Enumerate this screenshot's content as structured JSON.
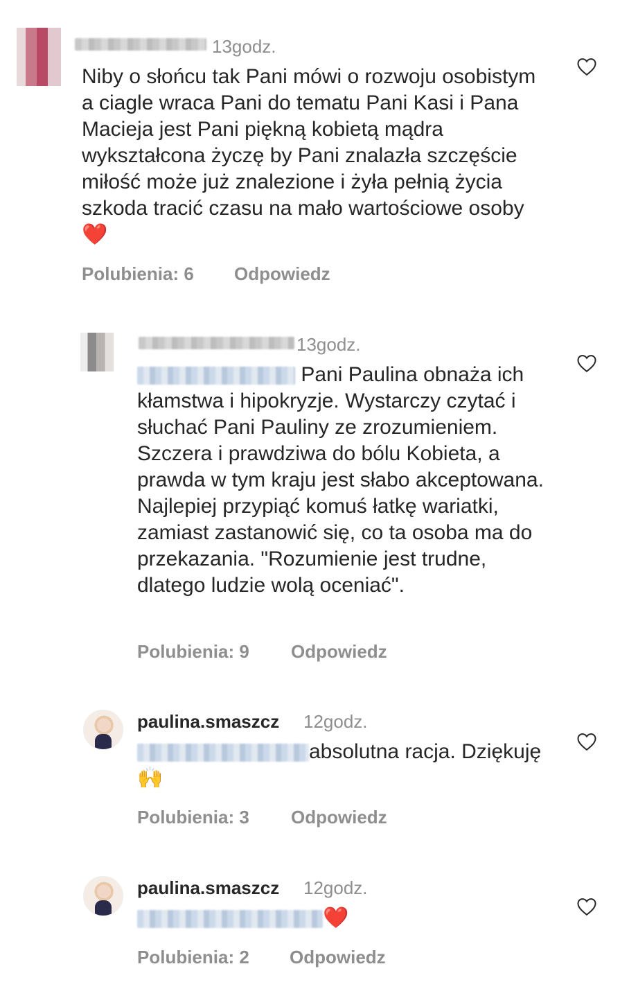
{
  "comments": [
    {
      "time": "13godz.",
      "text": "Niby o słońcu tak Pani mówi o rozwoju osobistym a ciagle wraca Pani do tematu Pani Kasi i Pana Macieja jest Pani piękną kobietą mądra wykształcona życzę by Pani znalazła szczęście miłość może już znalezione i żyła pełnią życia szkoda tracić czasu na mało wartościowe osoby",
      "emoji": "❤️",
      "likes": "Polubienia: 6",
      "reply": "Odpowiedz"
    },
    {
      "time": "13godz.",
      "text": " Pani Paulina obnaża ich kłamstwa i hipokryzje. Wystarczy czytać i słuchać Pani Pauliny ze zrozumieniem. Szczera i prawdziwa do bólu Kobieta, a prawda w tym kraju jest słabo akceptowana. Najlepiej przypiąć komuś łatkę wariatki, zamiast zastanowić się, co ta osoba ma do przekazania. \"Rozumienie jest trudne, dlatego ludzie wolą oceniać\".",
      "likes": "Polubienia: 9",
      "reply": "Odpowiedz"
    },
    {
      "username": "paulina.smaszcz",
      "time": "12godz.",
      "text": "absolutna racja. Dziękuję",
      "emoji": "🙌",
      "likes": "Polubienia: 3",
      "reply": "Odpowiedz"
    },
    {
      "username": "paulina.smaszcz",
      "time": "12godz.",
      "emoji": "❤️",
      "likes": "Polubienia: 2",
      "reply": "Odpowiedz"
    }
  ],
  "colors": {
    "text": "#262626",
    "muted": "#8e8e8e",
    "heart": "#e0242e"
  },
  "icons": {
    "like": "heart-outline-icon"
  }
}
